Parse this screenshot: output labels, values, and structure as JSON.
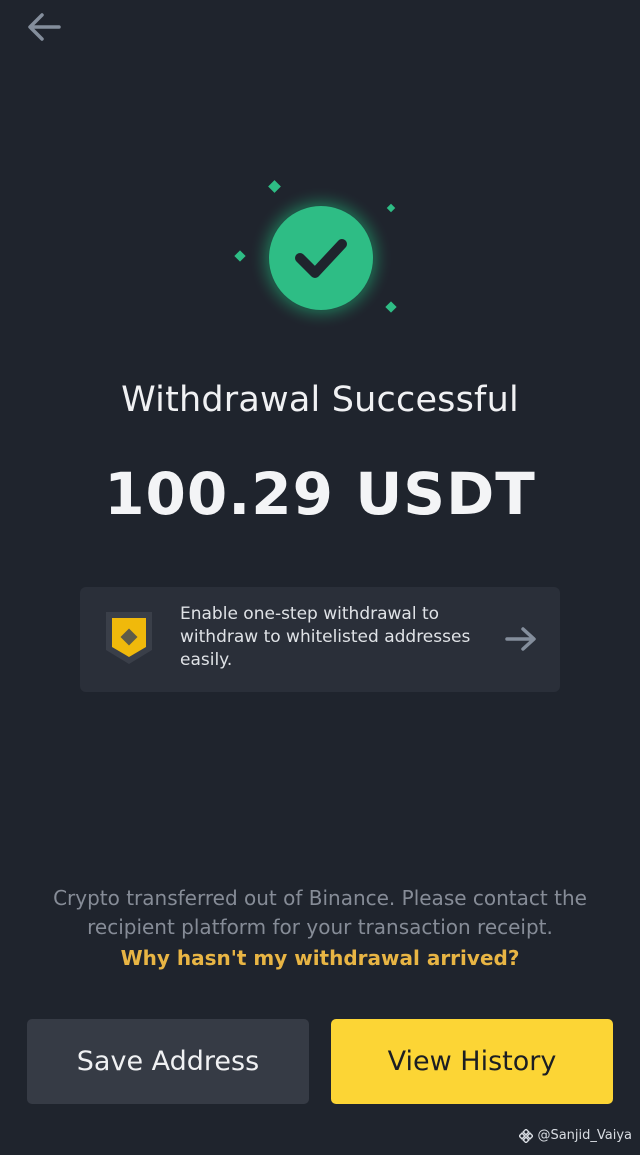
{
  "header": {
    "back_icon": "arrow-left-icon"
  },
  "status": {
    "icon": "check-circle-icon",
    "title": "Withdrawal Successful",
    "amount": "100.29 USDT"
  },
  "promo": {
    "icon": "shield-icon",
    "text": "Enable one-step withdrawal to withdraw to whitelisted addresses easily.",
    "arrow_icon": "arrow-right-icon"
  },
  "info": {
    "note": "Crypto transferred out of Binance. Please contact the recipient platform for your transaction receipt.",
    "link": "Why hasn't my withdrawal arrived?"
  },
  "actions": {
    "save_label": "Save Address",
    "history_label": "View History"
  },
  "watermark": {
    "text": "@Sanjid_Vaiya",
    "icon": "binance-logo-icon"
  },
  "colors": {
    "background": "#1f242d",
    "success": "#2ebd85",
    "accent_yellow": "#fcd535",
    "link_gold": "#e8b544",
    "card": "#2a2f39",
    "secondary_button": "#363b45"
  }
}
